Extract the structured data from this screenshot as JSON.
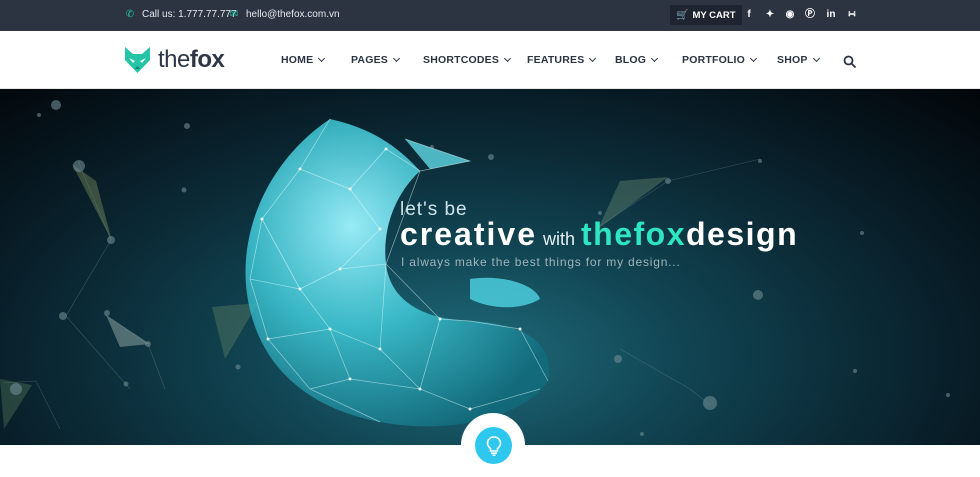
{
  "topbar": {
    "phone": "Call us: 1.777.77.777",
    "email": "hello@thefox.com.vn",
    "cart_label": "MY CART",
    "social_icons": [
      "facebook-icon",
      "twitter-icon",
      "dribbble-icon",
      "pinterest-icon",
      "linkedin-icon",
      "rss-icon"
    ]
  },
  "logo": {
    "text_light": "the",
    "text_bold": "fox"
  },
  "menu": [
    {
      "label": "HOME"
    },
    {
      "label": "PAGES"
    },
    {
      "label": "SHORTCODES"
    },
    {
      "label": "FEATURES"
    },
    {
      "label": "BLOG"
    },
    {
      "label": "PORTFOLIO"
    },
    {
      "label": "SHOP"
    }
  ],
  "hero": {
    "line1": "let's be",
    "word1": "creative",
    "word2": "with",
    "word3": "thefox",
    "word4": "design",
    "subtitle": "I always make the best things for my design..."
  },
  "colors": {
    "accent": "#2ee6c2",
    "brand_green": "#25c4a6",
    "topbar": "#2c3442",
    "badge_blue": "#2ec8ef"
  }
}
